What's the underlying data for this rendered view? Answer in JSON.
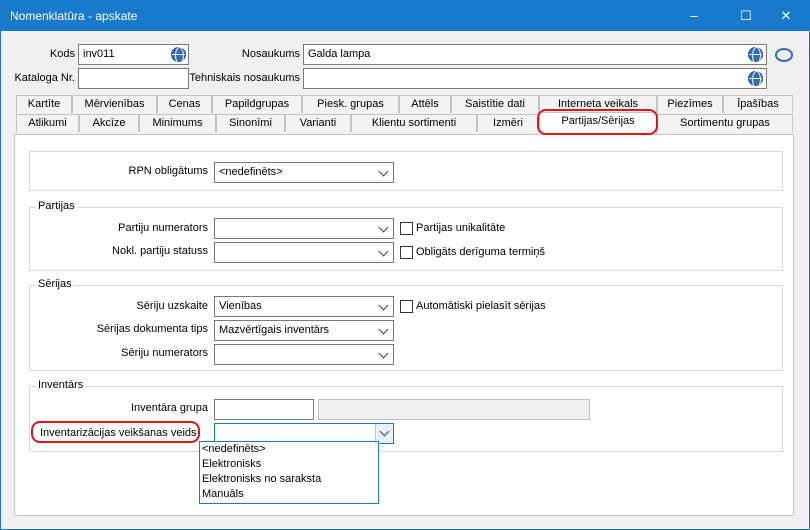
{
  "window": {
    "title": "Nomenklatūra - apskate",
    "minimize": "–",
    "maximize": "☐",
    "close": "✕"
  },
  "header": {
    "kods_label": "Kods",
    "kods_value": "inv011",
    "nosaukums_label": "Nosaukums",
    "nosaukums_value": "Galda lampa",
    "kataloga_label": "Kataloga Nr.",
    "kataloga_value": "",
    "tehniskais_label": "Tehniskais nosaukums",
    "tehniskais_value": ""
  },
  "tabs_row1": [
    "Kartīte",
    "Mērvienības",
    "Cenas",
    "Papildgrupas",
    "Piesk. grupas",
    "Attēls",
    "Saistītie dati",
    "Interneta veikals",
    "Piezīmes",
    "Īpašības"
  ],
  "tabs_row2": [
    "Atlikumi",
    "Akcīze",
    "Minimums",
    "Sinonīmi",
    "Varianti",
    "Klientu sortimenti",
    "Izmēri",
    "Partijas/Sērijas",
    "Sortimentu grupas"
  ],
  "rpn": {
    "label": "RPN obligātums",
    "value": "<nedefinēts>"
  },
  "partijas": {
    "title": "Partijas",
    "numerators_label": "Partiju numerators",
    "numerators_value": "",
    "statuss_label": "Nokl. partiju statuss",
    "statuss_value": "",
    "unikalitate_label": "Partijas unikalitāte",
    "termins_label": "Obligāts derīguma termiņš"
  },
  "serijas": {
    "title": "Sērijas",
    "uzskaite_label": "Sēriju uzskaite",
    "uzskaite_value": "Vienības",
    "dok_tips_label": "Sērijas dokumenta tips",
    "dok_tips_value": "Mazvērtīgais inventārs",
    "numerators_label": "Sēriju numerators",
    "numerators_value": "",
    "auto_label": "Automātiski pielasīt sērijas"
  },
  "inventars": {
    "title": "Inventārs",
    "grupa_label": "Inventāra grupa",
    "grupa_value": "",
    "grupa_name": "",
    "veids_label": "Inventarizācijas veikšanas veids",
    "veids_value": "",
    "options": [
      "<nedefinēts>",
      "Elektronisks",
      "Elektronisks no saraksta",
      "Manuāls"
    ]
  },
  "colors": {
    "titlebar": "#1979ca",
    "highlight": "#e0161b"
  }
}
